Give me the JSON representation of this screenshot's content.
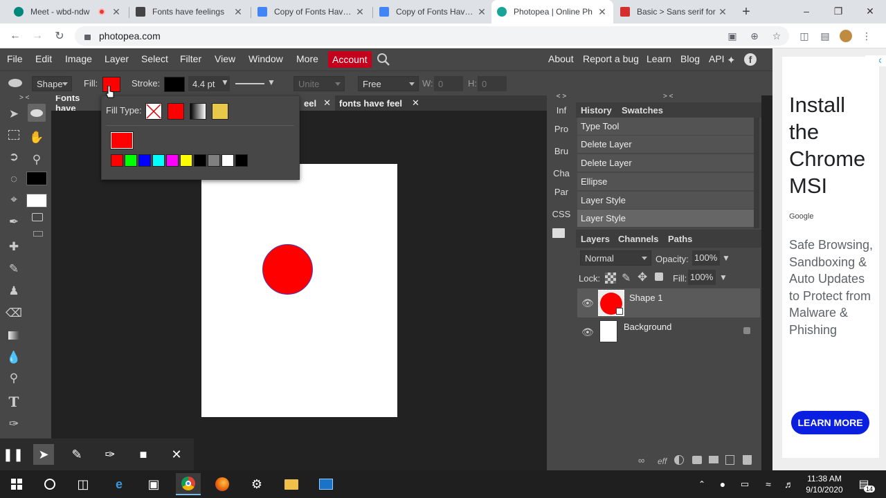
{
  "browser": {
    "tabs": [
      {
        "label": "Meet - wbd-ndw",
        "icon_color": "#00897b"
      },
      {
        "label": "Fonts have feelings",
        "icon_color": "#444444"
      },
      {
        "label": "Copy of Fonts Have F",
        "icon_color": "#4285f4"
      },
      {
        "label": "Copy of Fonts Have F",
        "icon_color": "#4285f4"
      },
      {
        "label": "Photopea | Online Ph",
        "icon_color": "#18a497"
      },
      {
        "label": "Basic > Sans serif for",
        "icon_color": "#d32f2f"
      }
    ],
    "new_tab": "+",
    "url": "photopea.com",
    "win_minimize": "–",
    "win_restore": "❐",
    "win_close": "✕"
  },
  "menu": {
    "items": [
      "File",
      "Edit",
      "Image",
      "Layer",
      "Select",
      "Filter",
      "View",
      "Window",
      "More"
    ],
    "account": "Account",
    "right_items": [
      "About",
      "Report a bug",
      "Learn",
      "Blog",
      "API"
    ]
  },
  "options": {
    "shape_mode": "Shape",
    "fill_label": "Fill:",
    "fill_color": "#ff0000",
    "stroke_label": "Stroke:",
    "stroke_color": "#000000",
    "stroke_width": "4.4 pt",
    "combine": "Unite",
    "size_mode": "Free",
    "w_label": "W:",
    "w_value": "0",
    "h_label": "H:",
    "h_value": "0"
  },
  "fill_popup": {
    "title": "Fill Type:",
    "current_color": "#ff0000",
    "swatches": [
      "#ff0000",
      "#00ff00",
      "#0000ff",
      "#00ffff",
      "#ff00ff",
      "#ffff00",
      "#000000",
      "#808080",
      "#ffffff",
      "#000000"
    ]
  },
  "documents": {
    "tabs": [
      {
        "label": "Fonts have"
      },
      {
        "label": "eel"
      },
      {
        "label": "fonts have feel"
      }
    ],
    "close": "✕",
    "collapse_left": "> <"
  },
  "canvas": {
    "page_color": "#ffffff",
    "circle_color": "#ff0000"
  },
  "mini_panel": {
    "collapse": "< >",
    "items": [
      "Inf",
      "Pro",
      "Bru",
      "Cha",
      "Par",
      "CSS"
    ]
  },
  "history": {
    "collapse": "> <",
    "tabs": [
      "History",
      "Swatches"
    ],
    "items": [
      "Type Tool",
      "Delete Layer",
      "Delete Layer",
      "Ellipse",
      "Layer Style",
      "Layer Style"
    ]
  },
  "layers": {
    "tabs": [
      "Layers",
      "Channels",
      "Paths"
    ],
    "blend_mode": "Normal",
    "opacity_label": "Opacity:",
    "opacity_value": "100%",
    "lock_label": "Lock:",
    "fill_label": "Fill:",
    "fill_value": "100%",
    "items": [
      {
        "name": "Shape 1",
        "selected": true
      },
      {
        "name": "Background",
        "selected": false
      }
    ],
    "footer_fx": "eff"
  },
  "ad": {
    "headline": "Install the Chrome MSI",
    "brand": "Google",
    "body": "Safe Browsing, Sandboxing & Auto Updates to Protect from Malware & Phishing",
    "cta": "LEARN MORE"
  },
  "taskbar": {
    "time": "11:38 AM",
    "date": "9/10/2020",
    "notifications": "14"
  }
}
